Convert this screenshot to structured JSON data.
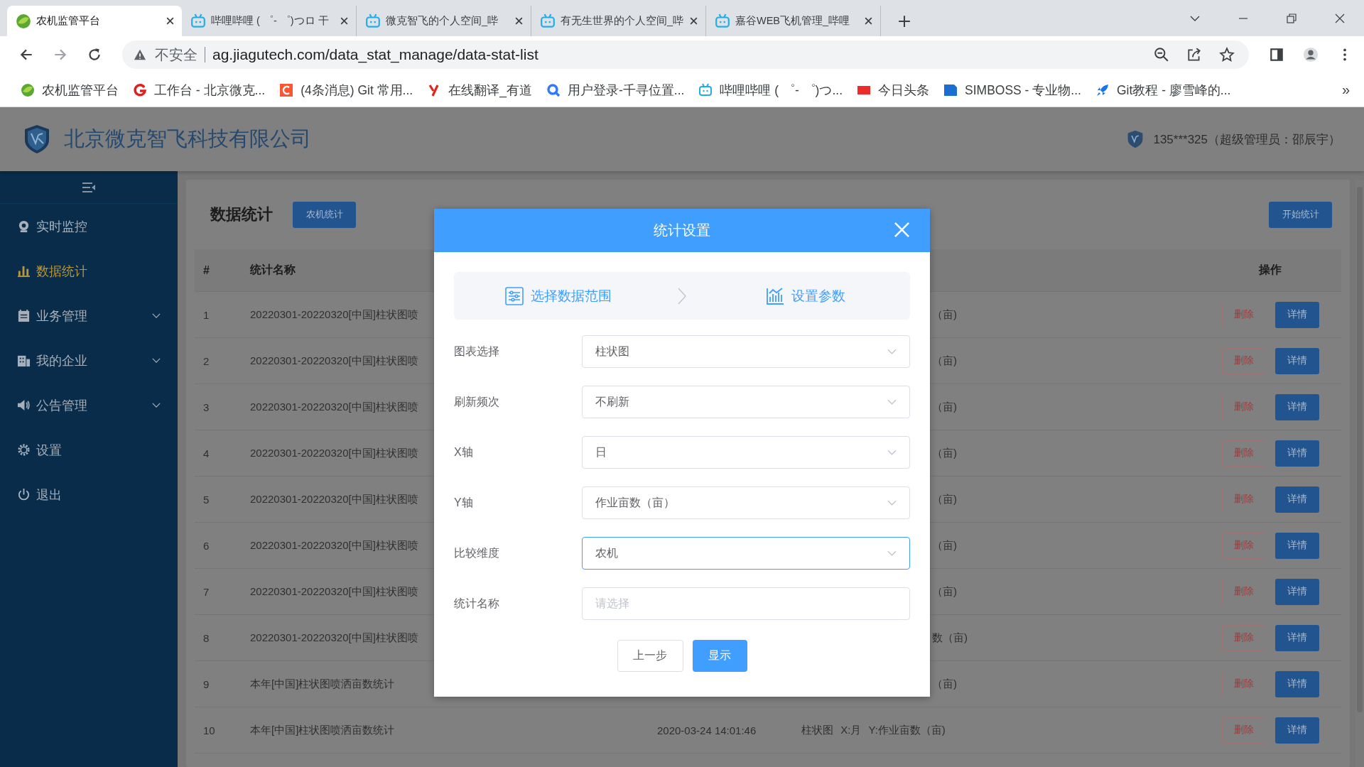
{
  "browser": {
    "tabs": [
      {
        "title": "农机监管平台",
        "selected": true
      },
      {
        "title": "哔哩哔哩 ( ゜- ゜)つロ 干",
        "selected": false
      },
      {
        "title": "微克智飞的个人空间_哔",
        "selected": false
      },
      {
        "title": "有无生世界的个人空间_哔",
        "selected": false
      },
      {
        "title": "嘉谷WEB飞机管理_哔哩",
        "selected": false
      }
    ],
    "security": "不安全",
    "url": "ag.jiagutech.com/data_stat_manage/data-stat-list",
    "bookmarks": [
      "农机监管平台",
      "工作台 - 北京微克...",
      "(4条消息) Git 常用...",
      "在线翻译_有道",
      "用户登录-千寻位置...",
      "哔哩哔哩 ( ゜- ゜)つ...",
      "今日头条",
      "SIMBOSS - 专业物...",
      "Git教程 - 廖雪峰的..."
    ],
    "more_bookmarks": "»"
  },
  "header": {
    "company": "北京微克智飞科技有限公司",
    "user": "135***325（超级管理员：邵辰宇）"
  },
  "sidebar": {
    "items": [
      {
        "label": "实时监控",
        "selected": false,
        "expandable": false
      },
      {
        "label": "数据统计",
        "selected": true,
        "expandable": false
      },
      {
        "label": "业务管理",
        "selected": false,
        "expandable": true
      },
      {
        "label": "我的企业",
        "selected": false,
        "expandable": true
      },
      {
        "label": "公告管理",
        "selected": false,
        "expandable": true
      },
      {
        "label": "设置",
        "selected": false,
        "expandable": false
      },
      {
        "label": "退出",
        "selected": false,
        "expandable": false
      }
    ]
  },
  "page": {
    "title": "数据统计",
    "filter_button": "农机统计",
    "start_button": "开始统计",
    "table": {
      "columns": {
        "index": "#",
        "name": "统计名称",
        "actions": "操作"
      },
      "rows": [
        {
          "index": "1",
          "name": "20220301-20220320[中国]柱状图喷",
          "description": "（亩)",
          "delete": "删除",
          "detail": "详情"
        },
        {
          "index": "2",
          "name": "20220301-20220320[中国]柱状图喷",
          "description": "（亩)",
          "delete": "删除",
          "detail": "详情"
        },
        {
          "index": "3",
          "name": "20220301-20220320[中国]柱状图喷",
          "description": "（亩)",
          "delete": "删除",
          "detail": "详情"
        },
        {
          "index": "4",
          "name": "20220301-20220320[中国]柱状图喷",
          "description": "（亩)",
          "delete": "删除",
          "detail": "详情"
        },
        {
          "index": "5",
          "name": "20220301-20220320[中国]柱状图喷",
          "description": "（亩)",
          "delete": "删除",
          "detail": "详情"
        },
        {
          "index": "6",
          "name": "20220301-20220320[中国]柱状图喷",
          "description": "（亩)",
          "delete": "删除",
          "detail": "详情"
        },
        {
          "index": "7",
          "name": "20220301-20220320[中国]柱状图喷",
          "description": "（亩)",
          "delete": "删除",
          "detail": "详情"
        },
        {
          "index": "8",
          "name": "20220301-20220320[中国]柱状图喷",
          "description": "数（亩)",
          "delete": "删除",
          "detail": "详情"
        },
        {
          "index": "9",
          "name": "本年[中国]柱状图喷洒亩数统计",
          "description": "（亩)",
          "delete": "删除",
          "detail": "详情"
        },
        {
          "index": "10",
          "name": "本年[中国]柱状图喷洒亩数统计",
          "time": "2020-03-24 14:01:46",
          "description": "柱状图 X:月 Y:作业亩数（亩)",
          "delete": "删除",
          "detail": "详情"
        }
      ]
    }
  },
  "dialog": {
    "title": "统计设置",
    "steps": [
      "选择数据范围",
      "设置参数"
    ],
    "fields": [
      {
        "label": "图表选择",
        "kind": "select",
        "value": "柱状图",
        "focused": false
      },
      {
        "label": "刷新频次",
        "kind": "select",
        "value": "不刷新",
        "focused": false
      },
      {
        "label": "X轴",
        "kind": "select",
        "value": "日",
        "focused": false
      },
      {
        "label": "Y轴",
        "kind": "select",
        "value": "作业亩数（亩）",
        "focused": false
      },
      {
        "label": "比较维度",
        "kind": "select",
        "value": "农机",
        "focused": true
      },
      {
        "label": "统计名称",
        "kind": "input",
        "placeholder": "请选择",
        "focused": false
      }
    ],
    "back_button": "上一步",
    "show_button": "显示"
  }
}
